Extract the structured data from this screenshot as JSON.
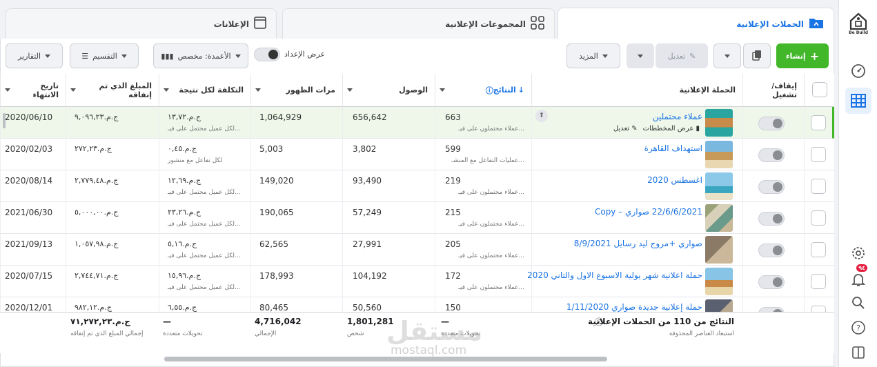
{
  "tabs": {
    "campaigns": "الحملات الإعلانية",
    "adsets": "المجموعات الإعلانية",
    "ads": "الإعلانات"
  },
  "toolbar": {
    "create": "إنشاء",
    "edit": "تعديل",
    "more": "المزيد",
    "view_setup": "عرض الإعداد",
    "columns": "الأعمدة: مخصص",
    "breakdown": "التقسيم",
    "reports": "التقارير"
  },
  "headers": {
    "toggle": "إيقاف/ تشغيل",
    "campaign": "الحملة الإعلانية",
    "results": "النتائج",
    "reach": "الوصول",
    "impressions": "مرات الظهور",
    "cost_per_result": "التكلفة لكل نتيجة",
    "amount_spent": "المبلغ الذي تم إنفاقه",
    "end_date": "تاريخ الانتهاء"
  },
  "rows": [
    {
      "name": "عملاء محتملين",
      "results": "663",
      "result_type": "عملاء محتملون على فيـ...",
      "reach": "656,642",
      "impressions": "1,064,929",
      "cost": "ج.م.١٣,٧٢",
      "cost_sub": "لكل عميل محتمل على فيـ...",
      "spent": "ج.م.٩,٠٩٦,٢٣",
      "end": "2020/06/10",
      "actions": {
        "chart": "عرض المخططات",
        "edit": "تعديل"
      }
    },
    {
      "name": "استهداف القاهرة",
      "results": "599",
      "result_type": "عمليات التفاعل مع المنشـ...",
      "reach": "3,802",
      "impressions": "5,003",
      "cost": "ج.م.٠,٤٥",
      "cost_sub": "لكل تفاعل مع منشور",
      "spent": "ج.م.٢٧٢,٢٣",
      "end": "2020/02/03"
    },
    {
      "name": "اغسطس 2020",
      "results": "219",
      "result_type": "عملاء محتملون على فيـ...",
      "reach": "93,490",
      "impressions": "149,020",
      "cost": "ج.م.١٢,٦٩",
      "cost_sub": "لكل عميل محتمل على فيـ...",
      "spent": "ج.م.٢,٧٧٩,٤٨",
      "end": "2020/08/14"
    },
    {
      "name": "22/6/6/2021 صواري – Copy",
      "results": "215",
      "result_type": "عملاء محتملون على فيـ...",
      "reach": "57,249",
      "impressions": "190,065",
      "cost": "ج.م.٢٣,٢٦",
      "cost_sub": "لكل عميل محتمل على فيـ...",
      "spent": "ج.م.٥,٠٠٠,٠٠",
      "end": "2021/06/30"
    },
    {
      "name": "صواري +مروج ليد رسايل 8/9/2021",
      "results": "205",
      "result_type": "عملاء محتملون على فيـ...",
      "reach": "27,991",
      "impressions": "62,565",
      "cost": "ج.م.٥,١٦",
      "cost_sub": "لكل عميل محتمل على فيـ...",
      "spent": "ج.م.١,٠٥٧,٩٨",
      "end": "2021/09/13"
    },
    {
      "name": "حملة اعلانية شهر يولية الاسبوع الاول والتاني 2020",
      "results": "172",
      "result_type": "عملاء محتملون على فيـ...",
      "reach": "104,192",
      "impressions": "178,993",
      "cost": "ج.م.١٥,٩٦",
      "cost_sub": "لكل عميل محتمل على فيـ...",
      "spent": "ج.م.٢,٧٤٤,٧١",
      "end": "2020/07/15"
    },
    {
      "name": "حملة إعلانية جديدة صواري 1/11/2020",
      "results": "150",
      "result_type": "",
      "reach": "50,560",
      "impressions": "80,465",
      "cost": "ج.م.٦,٥٥",
      "cost_sub": "",
      "spent": "ج.م.٩٨٢,١٢",
      "end": "2020/12/01"
    }
  ],
  "footer": {
    "title": "النتائج من 110 من الحملات الإعلانية",
    "sub": "استبعاد العناصر المحذوفة",
    "results": "—",
    "results_sub": "تحويلات متعددة",
    "reach": "1,801,281",
    "reach_sub": "شخص",
    "impressions": "4,716,042",
    "impressions_sub": "الإجمالي",
    "cost": "—",
    "cost_sub": "تحويلات متعددة",
    "spent": "ج.م.٧١,٢٧٢,٢٣",
    "spent_sub": "إجمالي المبلغ الذي تم إنفاقه"
  },
  "sidebar": {
    "logo": "Be Build",
    "notif_count": "٩٤"
  },
  "watermark": {
    "ar": "مستقل",
    "en": "mostaql.com"
  },
  "colors": {
    "accent": "#1b74e4",
    "create": "#42b72a",
    "highlight_row": "#eef7e9"
  }
}
